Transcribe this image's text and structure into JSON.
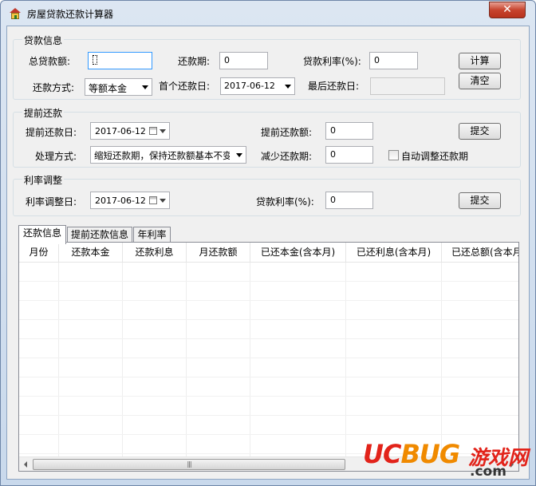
{
  "window": {
    "title": "房屋贷款还款计算器",
    "close": "✕"
  },
  "loan": {
    "group_title": "贷款信息",
    "total_label": "总贷款额:",
    "total_value": "",
    "period_label": "还款期:",
    "period_value": "0",
    "rate_label": "贷款利率(%):",
    "rate_value": "0",
    "method_label": "还款方式:",
    "method_value": "等额本金",
    "first_label": "首个还款日:",
    "first_value": "2017-06-12",
    "last_label": "最后还款日:",
    "last_value": "",
    "calc_button": "计算",
    "clear_button": "清空"
  },
  "prepay": {
    "group_title": "提前还款",
    "date_label": "提前还款日:",
    "date_value": "2017-06-12",
    "amount_label": "提前还款额:",
    "amount_value": "0",
    "mode_label": "处理方式:",
    "mode_value": "缩短还款期，保持还款额基本不变",
    "reduce_label": "减少还款期:",
    "reduce_value": "0",
    "auto_label": "自动调整还款期",
    "submit_button": "提交"
  },
  "rate_adjust": {
    "group_title": "利率调整",
    "date_label": "利率调整日:",
    "date_value": "2017-06-12",
    "rate_label": "贷款利率(%):",
    "rate_value": "0",
    "submit_button": "提交"
  },
  "tabs": [
    {
      "label": "还款信息",
      "active": true
    },
    {
      "label": "提前还款信息",
      "active": false
    },
    {
      "label": "年利率",
      "active": false
    }
  ],
  "table": {
    "columns": [
      "月份",
      "还款本金",
      "还款利息",
      "月还款额",
      "已还本金(含本月)",
      "已还利息(含本月)",
      "已还总额(含本月)"
    ],
    "rows": []
  },
  "scrollbar": {
    "thumb_grip": "|||"
  },
  "watermark": {
    "brand_uc": "UC",
    "brand_bug": "BUG",
    "cn": "游戏网",
    "com": ".com"
  }
}
